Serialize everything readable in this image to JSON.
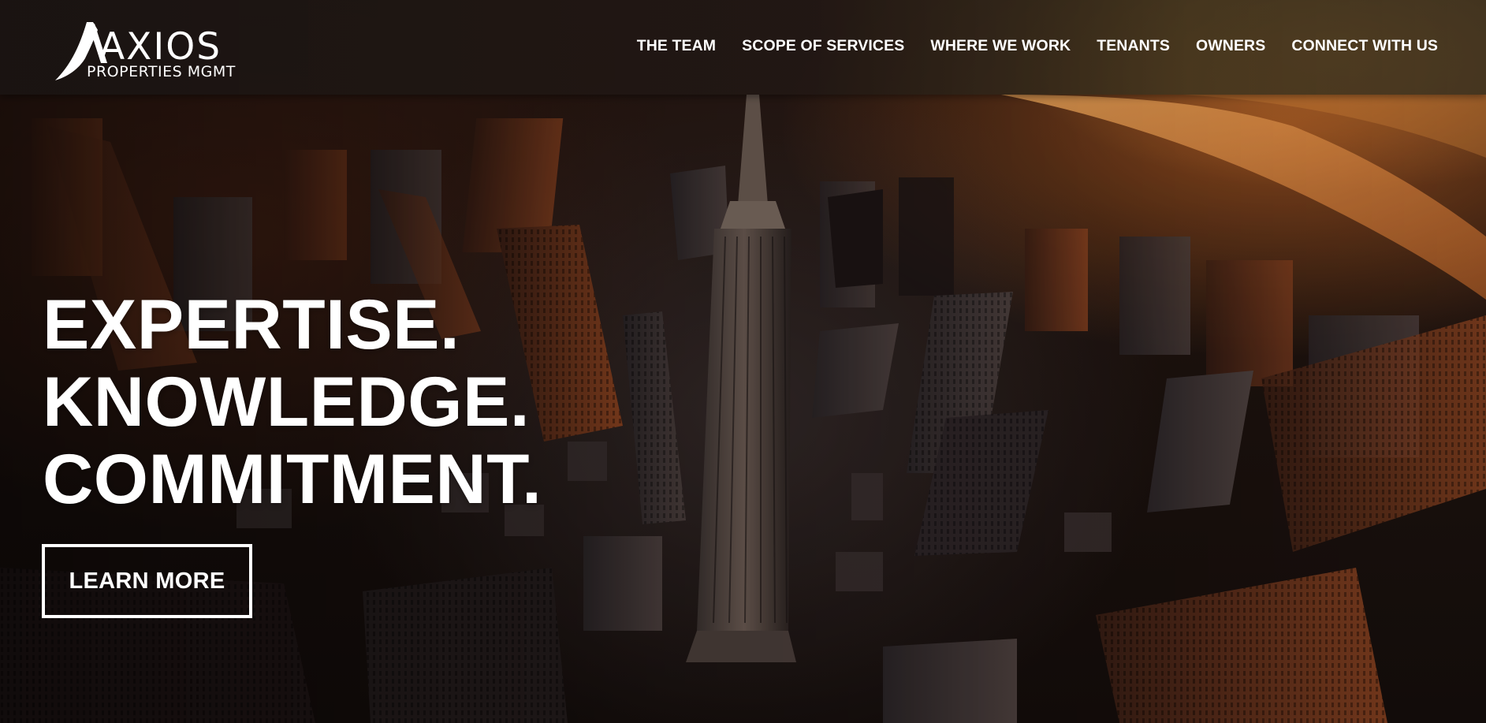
{
  "brand": {
    "name": "AXIOS",
    "tagline": "PROPERTIES MGMT",
    "logo_icon": "swoosh-a-logo-icon",
    "color": "#ffffff"
  },
  "nav": {
    "items": [
      {
        "label": "THE TEAM"
      },
      {
        "label": "SCOPE OF SERVICES"
      },
      {
        "label": "WHERE WE WORK"
      },
      {
        "label": "TENANTS"
      },
      {
        "label": "OWNERS"
      },
      {
        "label": "CONNECT WITH US"
      }
    ]
  },
  "hero": {
    "headline_lines": [
      "EXPERTISE.",
      "KNOWLEDGE.",
      "COMMITMENT."
    ],
    "cta_label": "LEARN MORE",
    "background": "aerial-city-sunset-image",
    "accent_colors": [
      "#e07a2c",
      "#ffb04f",
      "#2a1812"
    ]
  }
}
